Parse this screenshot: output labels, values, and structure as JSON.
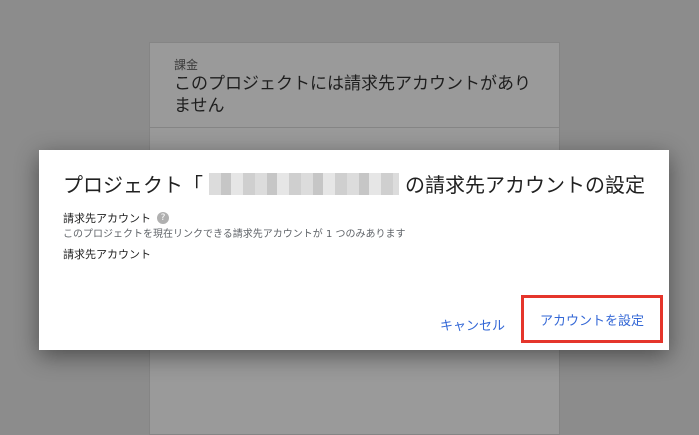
{
  "background": {
    "billing_label": "課金",
    "billing_text": "このプロジェクトには請求先アカウントがありません"
  },
  "dialog": {
    "title_prefix": "プロジェクト「",
    "title_suffix": "の請求先アカウントの設定",
    "field_label": "請求先アカウント",
    "field_description": "このプロジェクトを現在リンクできる請求先アカウントが 1 つのみあります",
    "field_label_2": "請求先アカウント",
    "help_icon_glyph": "?",
    "cancel_label": "キャンセル",
    "set_account_label": "アカウントを設定"
  },
  "colors": {
    "accent": "#3367d6",
    "highlight_border": "#e5352b",
    "overlay": "#8c8c8c"
  }
}
